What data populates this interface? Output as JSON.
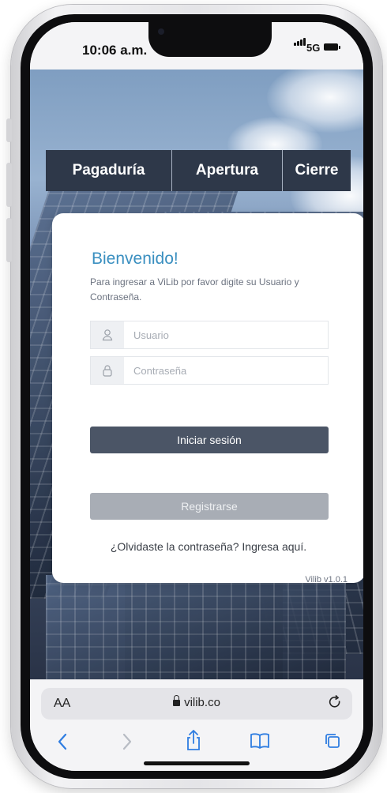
{
  "status": {
    "time": "10:06 a.m.",
    "network": "5G"
  },
  "nav": {
    "items": [
      {
        "label": "Pagaduría"
      },
      {
        "label": "Apertura"
      },
      {
        "label": "Cierre"
      }
    ]
  },
  "login": {
    "title": "Bienvenido!",
    "description": "Para ingresar a ViLib por favor digite su Usuario y Contraseña.",
    "username_placeholder": "Usuario",
    "password_placeholder": "Contraseña",
    "login_button": "Iniciar sesión",
    "register_button": "Registrarse",
    "forgot": "¿Olvidaste la contraseña? Ingresa aquí.",
    "version": "Vilib v1.0.1"
  },
  "browser": {
    "text_size_label": "AA",
    "url": "vilib.co",
    "toolbar_icons": [
      "back-icon",
      "forward-icon",
      "share-icon",
      "bookmarks-icon",
      "tabs-icon"
    ]
  },
  "colors": {
    "nav_bg": "#2e3849",
    "title_accent": "#3a8fc0",
    "login_button_bg": "#4b5566",
    "register_button_bg": "#a8adb5"
  }
}
